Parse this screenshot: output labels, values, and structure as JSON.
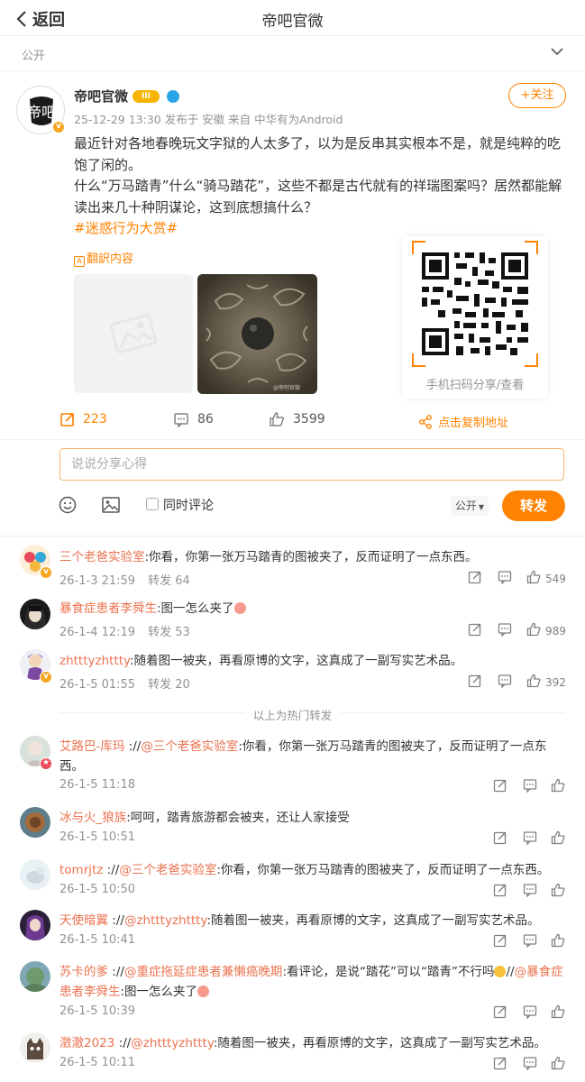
{
  "header": {
    "back_label": "返回",
    "title": "帝吧官微"
  },
  "visibility": {
    "label": "公开"
  },
  "post": {
    "author": "帝吧官微",
    "level_badge": "III",
    "avatar_text": "帝吧",
    "meta": "25-12-29 13:30 发布于 安徽 来自 中华有为Android",
    "follow_label": "+关注",
    "text_line1": "最近针对各地春晚玩文字狱的人太多了，以为是反串其实根本不是，就是纯粹的吃饱了闲的。",
    "text_line2": "什么“万马踏青”什么“骑马踏花”，这些不都是古代就有的祥瑞图案吗？居然都能解读出来几十种阴谋论，这到底想搞什么？",
    "hashtag": "#迷惑行为大赏#",
    "translate_label": "翻訳内容",
    "qr_caption": "手机扫码分享/查看",
    "watermark": "@帝吧官微",
    "reposts": "223",
    "comments": "86",
    "likes": "3599",
    "copy_link_label": "点击复制地址"
  },
  "composer": {
    "placeholder": "说说分享心得",
    "sync_label": "同时评论",
    "visibility": "公开",
    "submit_label": "转发"
  },
  "hot_reposts": [
    {
      "name": "三个老爸实验室",
      "text": ":你看，你第一张万马踏青的图被夹了，反而证明了一点东西。",
      "time": "26-1-3 21:59",
      "repost": "转发 64",
      "likes": "549"
    },
    {
      "name": "暴食症患者李舜生",
      "text": ":图一怎么夹了",
      "time": "26-1-4 12:19",
      "repost": "转发 53",
      "likes": "989"
    },
    {
      "name": "zhtttyzhttty",
      "text": ":随着图一被夹，再看原博的文字，这真成了一副写实艺术品。",
      "time": "26-1-5 01:55",
      "repost": "转发 20",
      "likes": "392"
    }
  ],
  "divider_label": "以上为热门转发",
  "reposts": [
    {
      "name": "艾路巴-库玛",
      "link": "@三个老爸实验室",
      "text_a": " ://",
      "text_b": ":你看，你第一张万马踏青的图被夹了，反而证明了一点东",
      "text_c": "西。",
      "time": "26-1-5 11:18"
    },
    {
      "name": "冰与火_狼族",
      "text": ":呵呵，踏青旅游都会被夹，还让人家接受",
      "time": "26-1-5 10:51"
    },
    {
      "name": "tomrjtz",
      "link": "@三个老爸实验室",
      "text_a": " ://",
      "text_b": ":你看，你第一张万马踏青的图被夹了，反而证明了一点东西。",
      "time": "26-1-5 10:50"
    },
    {
      "name": "天使暗翼",
      "link": "@zhtttyzhttty",
      "text_a": " ://",
      "text_b": ":随着图一被夹，再看原博的文字，这真成了一副写实艺术品。",
      "time": "26-1-5 10:41"
    },
    {
      "name": "苏卡的爹",
      "link": "@重症拖延症患者兼懒癌晚期",
      "link2": "@暴食症",
      "link3": "患者李舜生",
      "text_a": " ://",
      "text_b": ":看评论，是说“踏花”可以“踏青”不行吗",
      "text_c": "//",
      "text_d": ":图一怎么夹了",
      "time": "26-1-5 10:39"
    },
    {
      "name": "澂澈2023",
      "link": "@zhtttyzhttty",
      "text_a": " ://",
      "text_b": ":随着图一被夹，再看原博的文字，这真成了一副写实艺术品。",
      "time": "26-1-5 10:11"
    }
  ]
}
